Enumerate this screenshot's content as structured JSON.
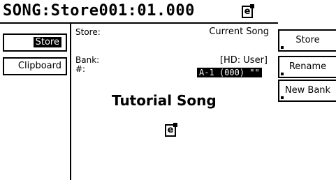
{
  "header": {
    "title": "SONG:Store001:01.000"
  },
  "tabs": [
    {
      "label": "Store"
    },
    {
      "label": "Clipboard"
    }
  ],
  "store_row": {
    "label": "Store:",
    "value": "Current Song"
  },
  "bank_row": {
    "label": "Bank:",
    "value": "[HD: User]"
  },
  "number_row": {
    "label": "#:",
    "value": "A-1 (000) \"\""
  },
  "main": {
    "song_name": "Tutorial Song"
  },
  "buttons": [
    {
      "label": "Store"
    },
    {
      "label": "Rename"
    },
    {
      "label": "New Bank"
    }
  ],
  "icons": {
    "header": "song-document-icon",
    "body": "song-document-icon"
  }
}
